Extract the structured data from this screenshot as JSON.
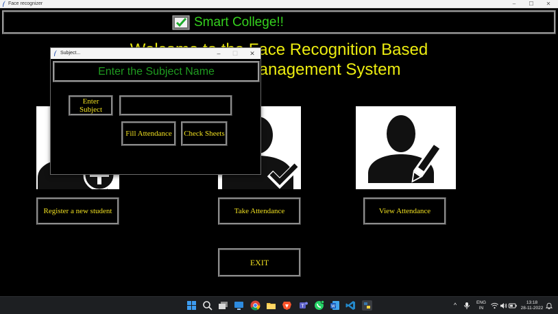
{
  "window": {
    "title": "Face recognizer",
    "controls": {
      "minimize": "–",
      "maximize": "☐",
      "close": "✕"
    }
  },
  "banner": {
    "text": "Smart College!!"
  },
  "welcome": {
    "line1": "Welcome to the Face Recognition Based",
    "line2": "Attendance Management System"
  },
  "buttons": {
    "register": "Register a new student",
    "take": "Take Attendance",
    "view": "View Attendance",
    "exit": "EXIT"
  },
  "dialog": {
    "title": "Subject...",
    "header": "Enter the Subject Name",
    "enter_subject": "Enter Subject",
    "subject_value": "",
    "fill_attendance": "Fill Attendance",
    "check_sheets": "Check Sheets",
    "controls": {
      "minimize": "–",
      "maximize": "☐",
      "close": "✕"
    }
  },
  "taskbar": {
    "icons": [
      "windows-start-icon",
      "search-icon",
      "task-view-icon",
      "widgets-icon",
      "chrome-icon",
      "file-explorer-icon",
      "brave-icon",
      "teams-icon",
      "whatsapp-icon",
      "word-icon",
      "vscode-icon",
      "python-icon"
    ],
    "tray": {
      "chevron": "^",
      "lang": "ENG",
      "region": "IN",
      "time": "13:18",
      "date": "28-11-2022"
    }
  },
  "colors": {
    "accent_yellow": "#ecec10",
    "banner_green": "#35d11e",
    "dialog_green": "#1f9b20",
    "button_text": "#f0e020",
    "background": "#000000"
  }
}
